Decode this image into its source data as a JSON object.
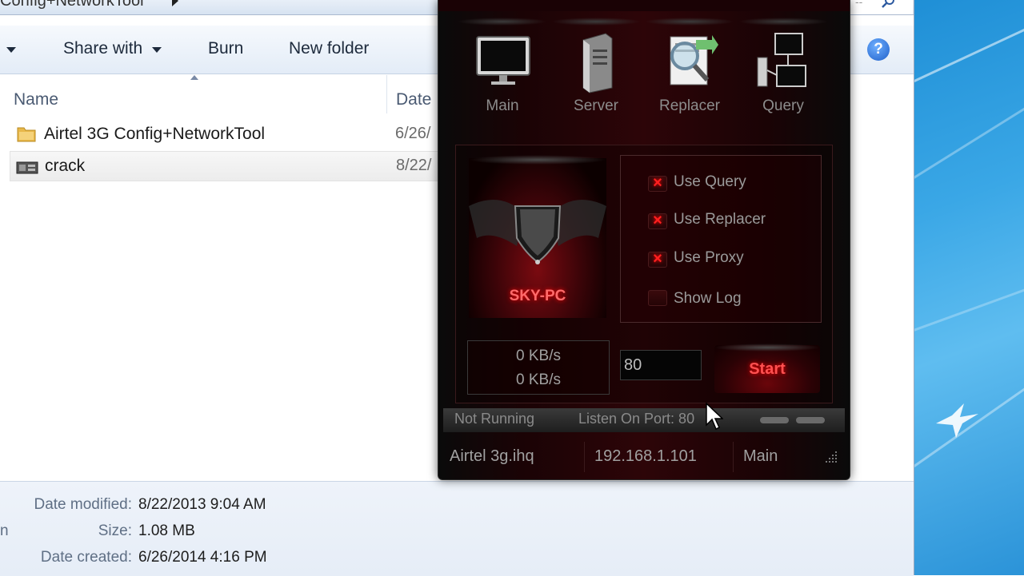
{
  "explorer": {
    "address": {
      "text": "Config+NetworkTool"
    },
    "toolbar": {
      "share_with": "Share with",
      "burn": "Burn",
      "new_folder": "New folder"
    },
    "columns": {
      "name": "Name",
      "date": "Date"
    },
    "files": [
      {
        "name": "Airtel 3G Config+NetworkTool",
        "date": "6/26/",
        "type": "folder"
      },
      {
        "name": "crack",
        "date": "8/22/",
        "type": "application"
      }
    ],
    "details": {
      "date_modified_label": "Date modified:",
      "date_modified": "8/22/2013 9:04 AM",
      "size_label": "Size:",
      "size": "1.08 MB",
      "date_created_label": "Date created:",
      "date_created": "6/26/2014 4:16 PM",
      "edge_char": "n"
    }
  },
  "tool": {
    "nav": [
      {
        "label": "Main",
        "icon": "monitor-icon"
      },
      {
        "label": "Server",
        "icon": "server-icon"
      },
      {
        "label": "Replacer",
        "icon": "replacer-icon"
      },
      {
        "label": "Query",
        "icon": "network-icon"
      }
    ],
    "pc_name": "SKY-PC",
    "options": [
      {
        "label": "Use Query",
        "checked": true
      },
      {
        "label": "Use Replacer",
        "checked": true
      },
      {
        "label": "Use Proxy",
        "checked": true
      },
      {
        "label": "Show Log",
        "checked": false
      }
    ],
    "speed_up": "0 KB/s",
    "speed_down": "0 KB/s",
    "port": "80",
    "start_label": "Start",
    "status": "Not Running",
    "listen_port": "Listen On Port: 80",
    "config_file": "Airtel 3g.ihq",
    "ip": "192.168.1.101",
    "mode": "Main",
    "accent": "#ff2020"
  }
}
